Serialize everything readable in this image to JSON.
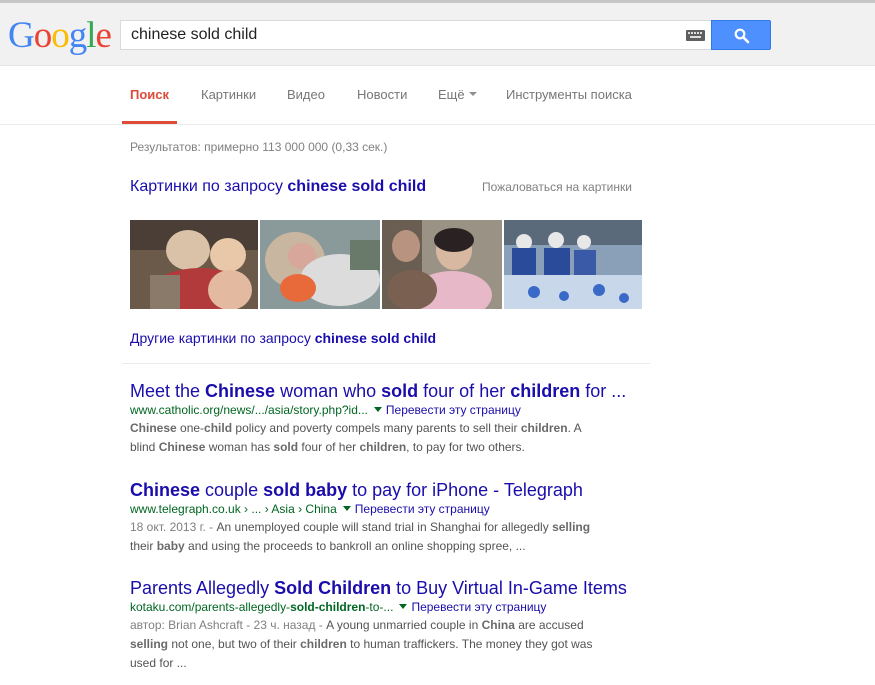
{
  "search": {
    "query": "chinese sold child",
    "logo": "Google"
  },
  "tabs": [
    "Поиск",
    "Картинки",
    "Видео",
    "Новости",
    "Ещё",
    "Инструменты поиска"
  ],
  "stats": "Результатов: примерно 113 000 000 (0,33 сек.)",
  "images": {
    "heading_prefix": "Картинки по запросу ",
    "heading_query": "chinese sold child",
    "report": "Пожаловаться на картинки",
    "more_prefix": "Другие картинки по запросу ",
    "more_query": "chinese sold child"
  },
  "results": [
    {
      "title_parts": [
        "Meet the ",
        "Chinese",
        " woman who ",
        "sold",
        " four of her ",
        "children",
        " for ..."
      ],
      "url": "www.catholic.org/news/.../asia/story.php?id...",
      "translate": "Перевести эту страницу",
      "snippet_lines": [
        [
          "Chinese",
          " one-",
          "child",
          " policy and poverty compels many parents to sell their ",
          "children",
          ". A"
        ],
        [
          "blind ",
          "Chinese",
          " woman has ",
          "sold",
          " four of her ",
          "children",
          ", to pay for two others."
        ]
      ]
    },
    {
      "title_parts": [
        "Chinese",
        " couple ",
        "sold baby",
        " to pay for iPhone - Telegraph"
      ],
      "url": "www.telegraph.co.uk › ... › Asia › China",
      "translate": "Перевести эту страницу",
      "date": "18 окт. 2013 г. - ",
      "snippet_lines": [
        [
          "An unemployed couple will stand trial in Shanghai for allegedly ",
          "selling"
        ],
        [
          "their ",
          "baby",
          " and using the proceeds to bankroll an online shopping spree, ..."
        ]
      ]
    },
    {
      "title_parts": [
        "Parents Allegedly ",
        "Sold Children",
        " to Buy Virtual In-Game Items"
      ],
      "url_parts": [
        "kotaku.com/parents-allegedly-",
        "sold-children",
        "-to-..."
      ],
      "translate": "Перевести эту страницу",
      "date": "автор: Brian Ashcraft - 23 ч. назад - ",
      "snippet_lines": [
        [
          "A young unmarried couple in ",
          "China",
          " are accused"
        ],
        [
          "selling",
          " not one, but two of their ",
          "children",
          " to human traffickers. The money they got was"
        ],
        [
          "used for ..."
        ]
      ]
    }
  ]
}
